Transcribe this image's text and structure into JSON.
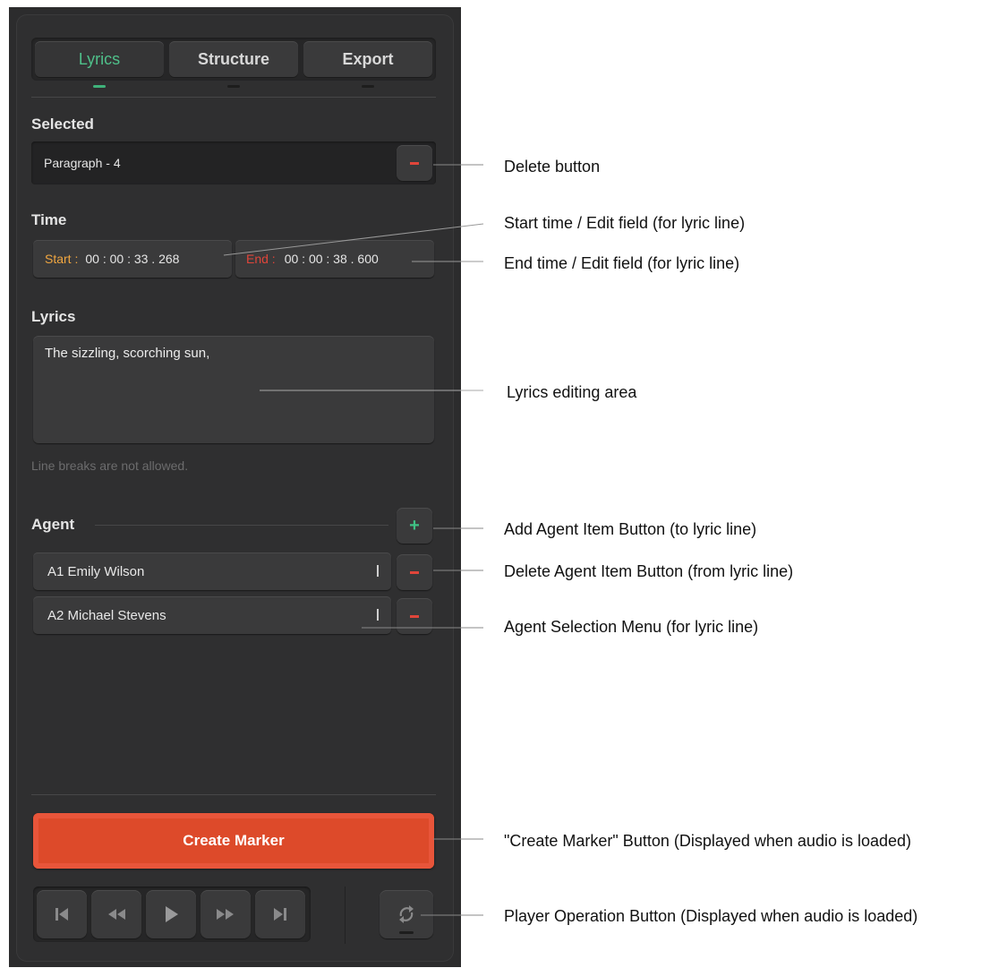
{
  "tabs": [
    {
      "label": "Lyrics",
      "active": true
    },
    {
      "label": "Structure",
      "active": false
    },
    {
      "label": "Export",
      "active": false
    }
  ],
  "selected": {
    "label": "Selected",
    "value": "Paragraph - 4",
    "delete_icon": "minus-icon"
  },
  "time": {
    "label": "Time",
    "start_label": "Start :",
    "start_value": "00 : 00 : 33 . 268",
    "end_label": "End :",
    "end_value": "00 : 00 : 38 . 600"
  },
  "lyrics": {
    "label": "Lyrics",
    "value": "The sizzling, scorching sun,",
    "hint": "Line breaks are not allowed."
  },
  "agent": {
    "label": "Agent",
    "add_icon": "plus-icon",
    "items": [
      {
        "text": "A1 Emily Wilson"
      },
      {
        "text": "A2 Michael Stevens"
      }
    ]
  },
  "create_marker": {
    "label": "Create Marker"
  },
  "player": {
    "buttons": [
      "skip-to-start-icon",
      "rewind-icon",
      "play-icon",
      "fast-forward-icon",
      "skip-to-end-icon"
    ],
    "loop_icon": "loop-icon"
  },
  "colors": {
    "accent_green": "#3fc084",
    "danger_red": "#e0453a",
    "start_orange": "#f0a640",
    "create_marker_red": "#dd4a2a",
    "panel_bg": "#2f2f30"
  },
  "annotations": {
    "delete_button": "Delete button",
    "start_time": "Start time / Edit field (for lyric line)",
    "end_time": "End time / Edit field (for lyric line)",
    "lyrics_area": "Lyrics editing area",
    "add_agent": "Add Agent Item Button (to lyric line)",
    "delete_agent": "Delete Agent Item Button (from lyric line)",
    "agent_menu": "Agent Selection Menu (for lyric line)",
    "create_marker": "\"Create Marker\" Button (Displayed when audio is loaded)",
    "player_buttons": "Player Operation Button (Displayed when audio is loaded)"
  }
}
